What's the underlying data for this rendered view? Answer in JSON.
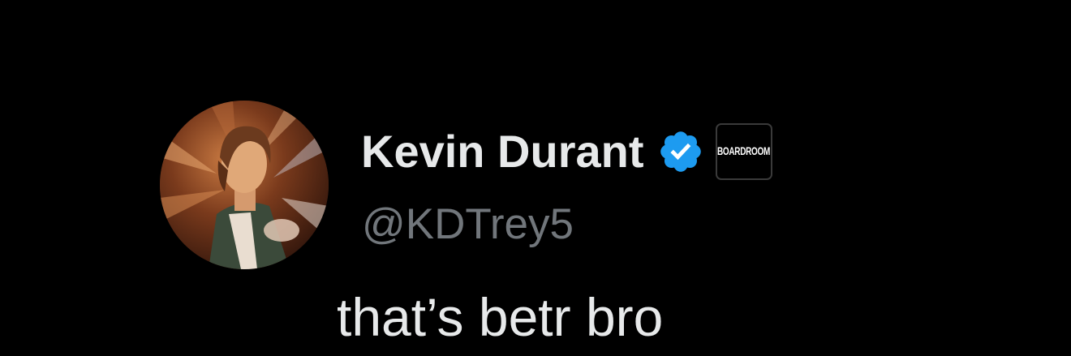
{
  "tweet": {
    "author": {
      "display_name": "Kevin Durant",
      "handle": "@KDTrey5",
      "verified": true,
      "affiliate_badge_label": "BOARDROOM",
      "avatar_icon": "profile-photo"
    },
    "text": "that’s betr bro"
  },
  "colors": {
    "background": "#000000",
    "name_text": "#e7e9ea",
    "handle_text": "#71767b",
    "verified_blue": "#1d9bf0"
  }
}
